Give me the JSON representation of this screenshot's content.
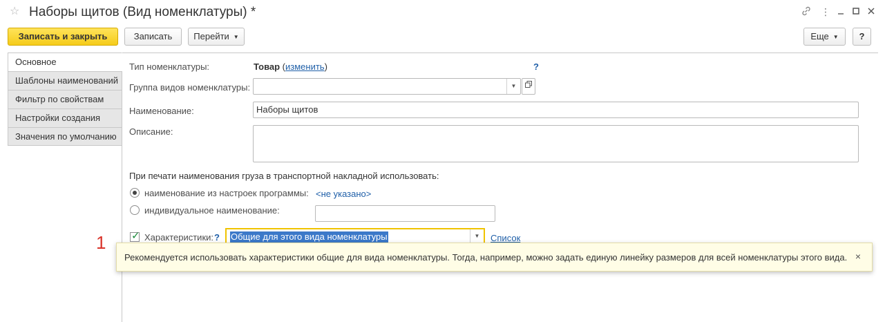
{
  "window": {
    "title": "Наборы щитов (Вид номенклатуры) *",
    "icons": [
      "star-icon",
      "link-icon",
      "menu-icon",
      "minimize-icon",
      "maximize-icon",
      "close-icon"
    ]
  },
  "toolbar": {
    "save_close": "Записать и закрыть",
    "save": "Записать",
    "goto": "Перейти",
    "more": "Еще",
    "help": "?"
  },
  "tabs": [
    {
      "label": "Основное",
      "active": true
    },
    {
      "label": "Шаблоны наименований",
      "active": false
    },
    {
      "label": "Фильтр по свойствам",
      "active": false
    },
    {
      "label": "Настройки создания",
      "active": false
    },
    {
      "label": "Значения по умолчанию",
      "active": false
    }
  ],
  "form": {
    "type_label": "Тип номенклатуры:",
    "type_value": "Товар",
    "type_change": "изменить",
    "type_help": "?",
    "group_label": "Группа видов номенклатуры:",
    "group_value": "",
    "name_label": "Наименование:",
    "name_value": "Наборы щитов",
    "desc_label": "Описание:",
    "desc_value": "",
    "print_heading": "При печати наименования груза в транспортной накладной использовать:",
    "radio1_label": "наименование из настроек программы:",
    "radio1_value": "<не указано>",
    "radio2_label": "индивидуальное наименование:",
    "radio2_value": "",
    "char_label": "Характеристики:",
    "char_help": "?",
    "char_value": "Общие для этого вида номенклатуры",
    "char_list": "Список"
  },
  "tooltip": {
    "text": "Рекомендуется использовать характеристики общие для вида номенклатуры. Тогда, например, можно задать единую линейку размеров для всей номенклатуры этого вида.",
    "close": "×"
  },
  "annotation": {
    "marker": "1"
  }
}
